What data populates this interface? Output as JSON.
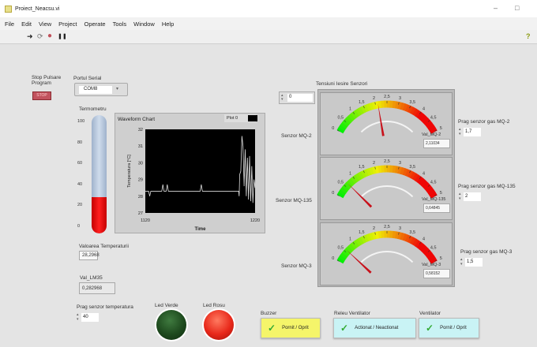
{
  "window": {
    "title": "Proiect_Neacsu.vi",
    "minimize": "–",
    "maximize": "□"
  },
  "menu": [
    "File",
    "Edit",
    "View",
    "Project",
    "Operate",
    "Tools",
    "Window",
    "Help"
  ],
  "toolbar": {
    "run": "➜",
    "run_continuous": "⟳",
    "abort": "●",
    "pause": "❚❚",
    "help": "?"
  },
  "stop": {
    "label": "Stop Pulsare Program",
    "button": "STOP"
  },
  "serial": {
    "label": "Portul Serial",
    "value": "COM8"
  },
  "thermometer": {
    "label": "Termometru",
    "ticks": [
      "100",
      "80",
      "60",
      "40",
      "20",
      "0"
    ],
    "value": 28.2968,
    "max": 100
  },
  "chart_data": {
    "type": "line",
    "title": "Waveform Chart",
    "legend": "Plot 0",
    "xlabel": "Time",
    "ylabel": "Temperatura [°C]",
    "xlim": [
      1120,
      1220
    ],
    "ylim": [
      27,
      32
    ],
    "yticks": [
      "32",
      "31",
      "30",
      "29",
      "28",
      "27"
    ],
    "xticks": [
      "1120",
      "1220"
    ],
    "points": [
      [
        1120,
        28.3
      ],
      [
        1123,
        28.3
      ],
      [
        1124,
        28.0
      ],
      [
        1125,
        28.3
      ],
      [
        1135,
        28.3
      ],
      [
        1136,
        28.7
      ],
      [
        1137,
        28.3
      ],
      [
        1139,
        28.3
      ],
      [
        1140,
        28.7
      ],
      [
        1141,
        28.3
      ],
      [
        1170,
        28.3
      ],
      [
        1171,
        28.7
      ],
      [
        1172,
        28.3
      ],
      [
        1205,
        28.3
      ],
      [
        1205.5,
        28.0
      ],
      [
        1206,
        29.3
      ],
      [
        1207,
        29.5
      ],
      [
        1208,
        31.6
      ],
      [
        1209,
        31.0
      ],
      [
        1210,
        28.6
      ],
      [
        1211,
        30.8
      ],
      [
        1212,
        28.0
      ],
      [
        1213,
        30.3
      ],
      [
        1214,
        27.8
      ],
      [
        1215,
        30.4
      ],
      [
        1216,
        27.7
      ],
      [
        1217,
        29.8
      ],
      [
        1218,
        27.6
      ],
      [
        1219,
        29.0
      ],
      [
        1220,
        28.5
      ]
    ]
  },
  "temperature": {
    "label": "Valoarea Temperaturii",
    "value": "28,2968"
  },
  "lm35": {
    "label": "Val_LM35",
    "value": "0,282968"
  },
  "temp_threshold": {
    "label": "Prag senzor temperatura",
    "value": "40"
  },
  "leds": {
    "green_label": "Led Verde",
    "red_label": "Led Rosu",
    "green_color": "#1e4a1e",
    "red_color": "#e8281a"
  },
  "buttons": {
    "buzzer_label": "Buzzer",
    "buzzer_text": "Pornit / Oprit",
    "relay_label": "Releu Ventilator",
    "relay_text": "Actionat / Neactionat",
    "fan_label": "Ventilator",
    "fan_text": "Pornit / Oprit"
  },
  "sensors": {
    "label": "Tensiuni Iesire Senzori",
    "index": "0",
    "scale": [
      "0",
      "0,5",
      "1",
      "1,5",
      "2",
      "2,5",
      "3",
      "3,5",
      "4",
      "4,5",
      "5"
    ],
    "items": [
      {
        "name": "Senzor MQ-2",
        "value_label": "Val_MQ-2",
        "value": 2.11034,
        "value_text": "2,11034",
        "threshold_label": "Prag senzor gas MQ-2",
        "threshold": "1,7"
      },
      {
        "name": "Senzor MQ-135",
        "value_label": "Val_MQ-135",
        "value": 0.64845,
        "value_text": "0,64845",
        "threshold_label": "Prag senzor gas MQ-135",
        "threshold": "2"
      },
      {
        "name": "Senzor MQ-3",
        "value_label": "Val_MQ-3",
        "value": 0.58152,
        "value_text": "0,58152",
        "threshold_label": "Prag senzor gas MQ-3",
        "threshold": "1,5"
      }
    ]
  }
}
